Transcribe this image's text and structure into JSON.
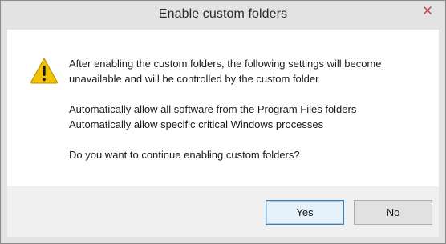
{
  "dialog": {
    "title": "Enable custom folders",
    "icon": "warning-icon",
    "message": {
      "line1": "After enabling the custom folders, the following settings will become",
      "line2": "unavailable and will be controlled by the custom folder",
      "setting1": "Automatically allow all software from the Program Files folders",
      "setting2": "Automatically allow specific critical Windows processes",
      "question": "Do you want to continue enabling custom folders?"
    },
    "buttons": {
      "yes": "Yes",
      "no": "No"
    },
    "colors": {
      "close": "#c75050",
      "warning": "#f2c200"
    }
  }
}
